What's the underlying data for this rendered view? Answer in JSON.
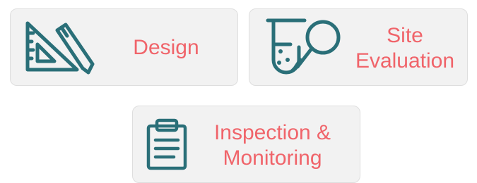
{
  "cards": [
    {
      "label_lines": [
        "Design"
      ],
      "icon": "ruler-triangle-pencil-icon"
    },
    {
      "label_lines": [
        "Site",
        "Evaluation"
      ],
      "icon": "test-tube-magnifier-icon"
    },
    {
      "label_lines": [
        "Inspection &",
        "Monitoring"
      ],
      "icon": "clipboard-icon"
    }
  ],
  "colors": {
    "accent": "#f0646a",
    "icon": "#2a6f78",
    "card_bg": "#f2f2f2"
  }
}
